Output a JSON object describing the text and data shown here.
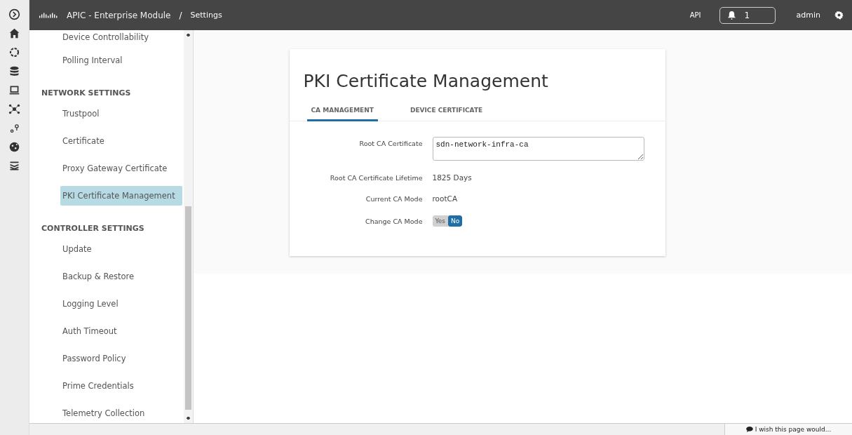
{
  "header": {
    "product": "APIC - Enterprise Module",
    "separator": "/",
    "page": "Settings",
    "api_link": "API",
    "notifications": {
      "count": "1"
    },
    "user": "admin"
  },
  "sidebar": {
    "sections": [
      {
        "items": [
          {
            "label": "Device Controllability",
            "selected": false
          },
          {
            "label": "Polling Interval",
            "selected": false
          }
        ]
      },
      {
        "heading": "NETWORK SETTINGS",
        "items": [
          {
            "label": "Trustpool",
            "selected": false
          },
          {
            "label": "Certificate",
            "selected": false
          },
          {
            "label": "Proxy Gateway Certificate",
            "selected": false
          },
          {
            "label": "PKI Certificate Management",
            "selected": true
          }
        ]
      },
      {
        "heading": "CONTROLLER SETTINGS",
        "items": [
          {
            "label": "Update",
            "selected": false
          },
          {
            "label": "Backup & Restore",
            "selected": false
          },
          {
            "label": "Logging Level",
            "selected": false
          },
          {
            "label": "Auth Timeout",
            "selected": false
          },
          {
            "label": "Password Policy",
            "selected": false
          },
          {
            "label": "Prime Credentials",
            "selected": false
          },
          {
            "label": "Telemetry Collection",
            "selected": false
          }
        ]
      }
    ]
  },
  "card": {
    "title": "PKI Certificate Management",
    "tabs": [
      {
        "label": "CA MANAGEMENT",
        "selected": true
      },
      {
        "label": "DEVICE CERTIFICATE",
        "selected": false
      }
    ],
    "fields": [
      {
        "kind": "textarea",
        "label": "Root CA Certificate",
        "value": "sdn-network-infra-ca"
      },
      {
        "kind": "text",
        "label": "Root CA Certificate Lifetime",
        "value": "1825 Days"
      },
      {
        "kind": "text",
        "label": "Current CA Mode",
        "value": "rootCA"
      },
      {
        "kind": "toggle",
        "label": "Change CA Mode",
        "options": [
          {
            "label": "Yes",
            "selected": false
          },
          {
            "label": "No",
            "selected": true
          }
        ]
      }
    ]
  },
  "feedback": "I wish this page would..."
}
